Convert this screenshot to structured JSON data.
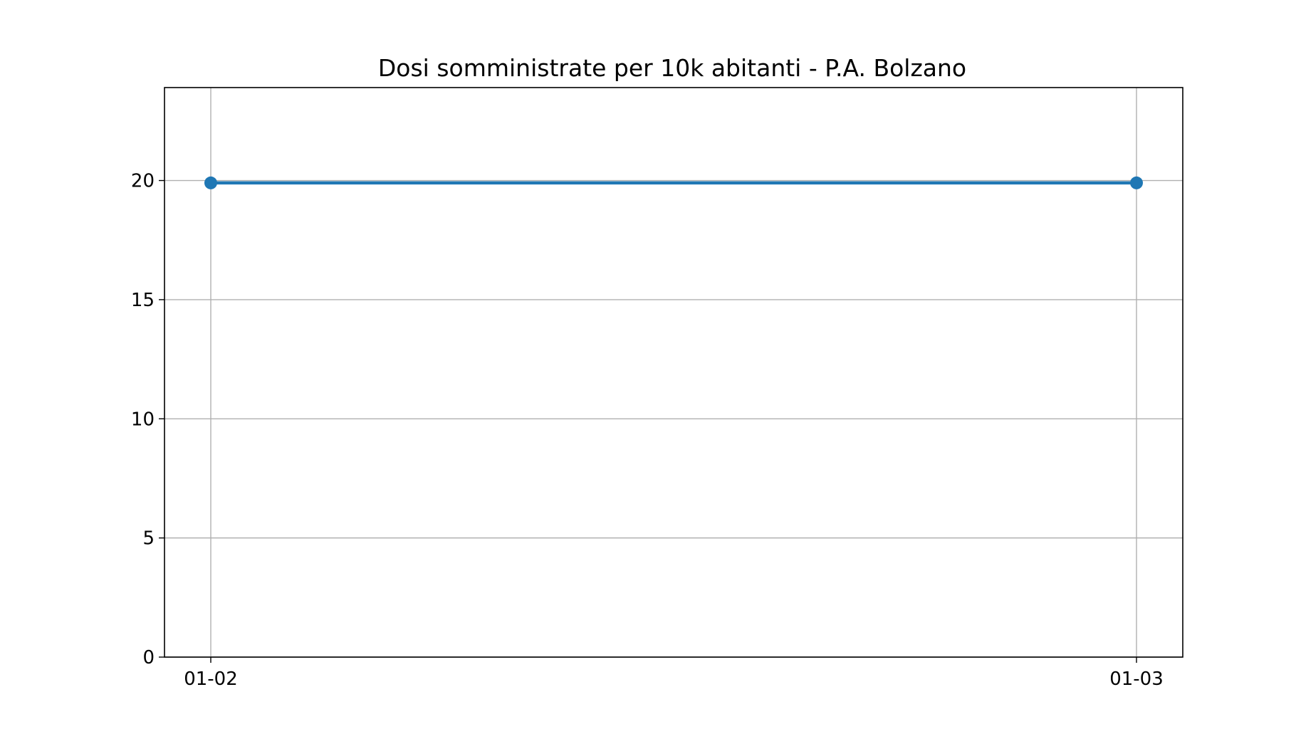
{
  "chart_data": {
    "type": "line",
    "title": "Dosi somministrate per 10k abitanti - P.A. Bolzano",
    "xlabel": "",
    "ylabel": "",
    "x": [
      "01-02",
      "01-03"
    ],
    "series": [
      {
        "values": [
          19.9,
          19.9
        ],
        "color": "#1f77b4",
        "marker": "circle"
      }
    ],
    "ylim": [
      0,
      23.9
    ],
    "yticks": [
      0,
      5,
      10,
      15,
      20
    ],
    "xticks": [
      "01-02",
      "01-03"
    ],
    "grid": true,
    "legend": "none"
  }
}
